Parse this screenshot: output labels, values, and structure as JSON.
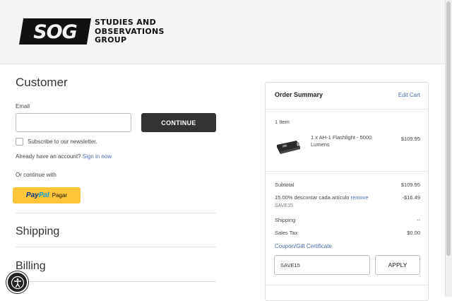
{
  "header": {
    "logo_mark": "SOG",
    "logo_text_lines": [
      "STUDIES AND",
      "OBSERVATIONS",
      "GROUP"
    ]
  },
  "customer": {
    "title": "Customer",
    "email_label": "Email",
    "email_value": "",
    "continue_label": "CONTINUE",
    "subscribe_label": "Subscribe to our newsletter.",
    "account_text": "Already have an account?",
    "signin_link": "Sign in now",
    "or_continue": "Or continue with",
    "paypal_pay": "Pay",
    "paypal_pal": "Pal",
    "paypal_pagar": "Pagar"
  },
  "sections": {
    "shipping": "Shipping",
    "billing": "Billing"
  },
  "summary": {
    "title": "Order Summary",
    "edit_cart": "Edit Cart",
    "items_count": "1 Item",
    "product_name": "1 x AH-1 Flashlight - 5000 Lumens",
    "product_price": "$109.95",
    "subtotal_label": "Subtotal",
    "subtotal_value": "$109.95",
    "discount_label": "15.00% descontar cada artículo",
    "remove_link": "remove",
    "discount_value": "-$16.49",
    "discount_code": "SAVE15",
    "shipping_label": "Shipping",
    "shipping_value": "--",
    "tax_label": "Sales Tax",
    "tax_value": "$0.00",
    "coupon_link": "Coupon/Gift Certificate",
    "coupon_value": "SAVE15",
    "apply_label": "APPLY"
  },
  "colors": {
    "link": "#4a6fb0",
    "button_dark": "#333333",
    "paypal_yellow": "#ffc439"
  }
}
